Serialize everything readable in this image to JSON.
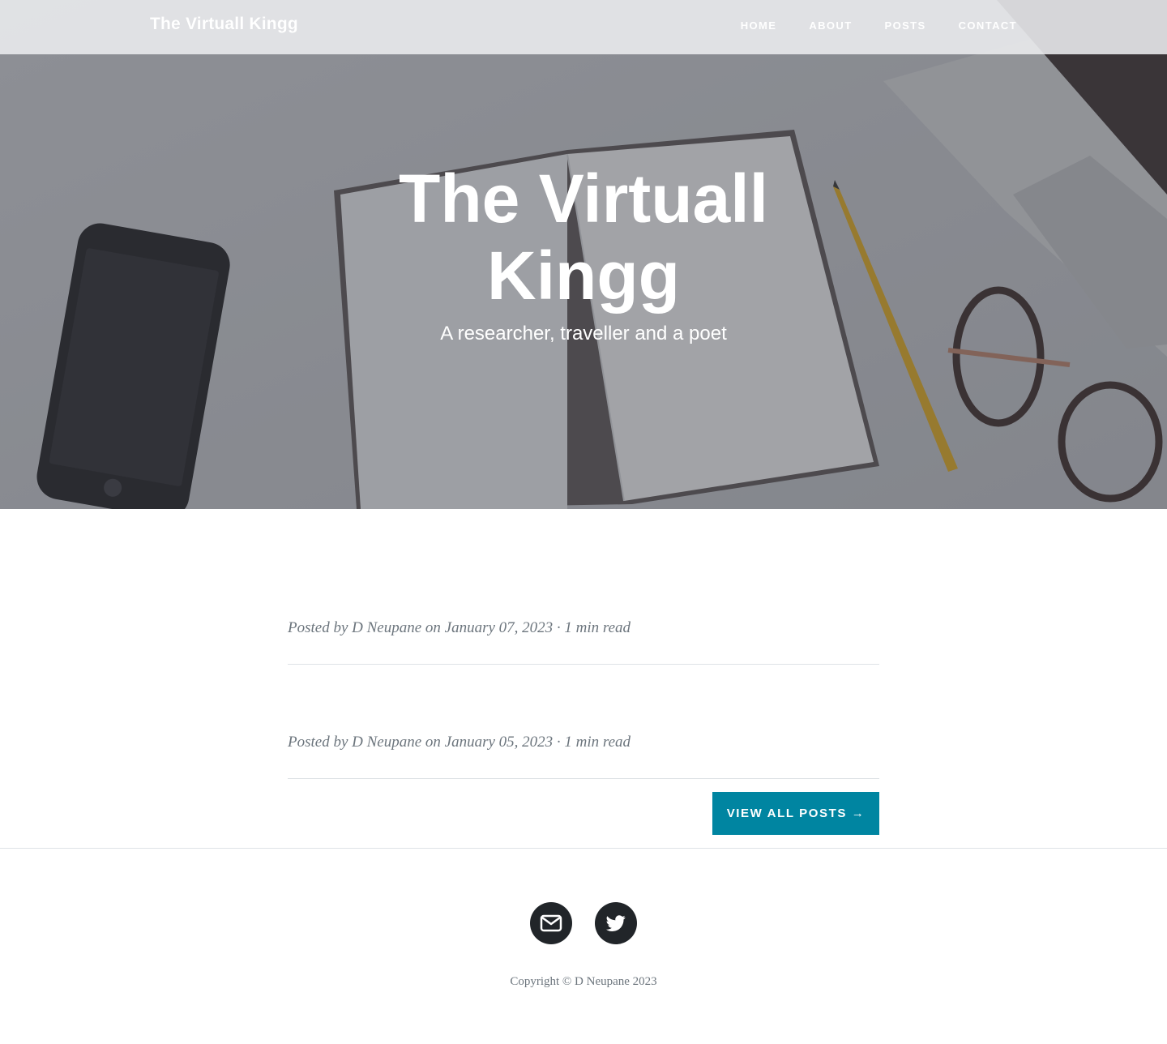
{
  "nav": {
    "brand": "The Virtuall Kingg",
    "links": [
      "Home",
      "About",
      "Posts",
      "Contact"
    ]
  },
  "hero": {
    "title_line1": "The Virtuall",
    "title_line2": "Kingg",
    "subtitle": "A researcher, traveller and a poet"
  },
  "posts": [
    {
      "meta": "Posted by D Neupane on January 07, 2023 · 1 min read"
    },
    {
      "meta": "Posted by D Neupane on January 05, 2023 · 1 min read"
    }
  ],
  "view_all_label": "View All Posts →",
  "footer": {
    "social": [
      "envelope-icon",
      "twitter-icon"
    ],
    "copyright": "Copyright © D Neupane 2023"
  },
  "colors": {
    "accent": "#0085a1",
    "dark": "#212529",
    "muted": "#6c757d"
  }
}
